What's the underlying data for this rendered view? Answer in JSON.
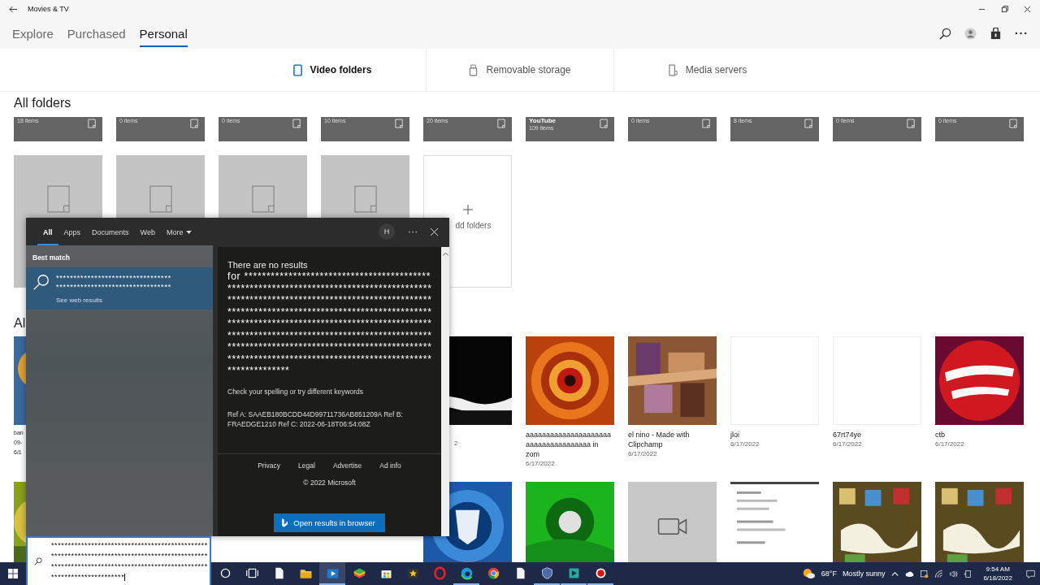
{
  "window": {
    "title": "Movies & TV"
  },
  "nav_tabs": [
    {
      "label": "Explore",
      "selected": false
    },
    {
      "label": "Purchased",
      "selected": false
    },
    {
      "label": "Personal",
      "selected": true
    }
  ],
  "sources": [
    {
      "label": "Video folders",
      "selected": true,
      "kind": "device"
    },
    {
      "label": "Removable storage",
      "selected": false,
      "kind": "usb"
    },
    {
      "label": "Media servers",
      "selected": false,
      "kind": "server"
    }
  ],
  "folders": {
    "heading": "All folders",
    "top_row": [
      {
        "count": "18 items"
      },
      {
        "count": "0 items"
      },
      {
        "count": "0 items"
      },
      {
        "count": "10 items"
      },
      {
        "count": "20 items"
      },
      {
        "name": "YouTube",
        "count": "109 items"
      },
      {
        "count": "0 items"
      },
      {
        "count": "8 items"
      },
      {
        "count": "0 items"
      },
      {
        "count": "0 items"
      }
    ],
    "add_label": "dd folders"
  },
  "videos": {
    "heading": "Al",
    "left_fragment": [
      "ban",
      "09-",
      "6/1"
    ],
    "peek_date": "2",
    "row1": [
      {
        "title": "aaaaaaaaaaaaaaaaaaaaa aaaaaaaaaaaaaaaa in zom",
        "date": "6/17/2022",
        "kind": "picture"
      },
      {
        "title": "el nino - Made with Clipchamp",
        "date": "6/17/2022",
        "kind": "picture"
      },
      {
        "title": "jloi",
        "date": "6/17/2022",
        "kind": "blank"
      },
      {
        "title": "67rt74ye",
        "date": "6/17/2022",
        "kind": "blank"
      },
      {
        "title": "ctb",
        "date": "6/17/2022",
        "kind": "picture"
      }
    ],
    "row2": [
      {
        "kind": "picture"
      },
      {
        "kind": "picture"
      },
      {
        "kind": "placeholder"
      },
      {
        "kind": "picture"
      },
      {
        "kind": "picture"
      },
      {
        "kind": "picture"
      }
    ]
  },
  "search": {
    "tabs": [
      {
        "label": "All",
        "selected": true
      },
      {
        "label": "Apps",
        "selected": false
      },
      {
        "label": "Documents",
        "selected": false
      },
      {
        "label": "Web",
        "selected": false
      },
      {
        "label": "More",
        "selected": false
      }
    ],
    "user_initial": "H",
    "section": "Best match",
    "best_match_lines": [
      "*********************************",
      "*********************************"
    ],
    "see_web": "See web results",
    "no_results": "There are no results",
    "query": "for ******************************************************************************************************************************************************************************************************************************************************************************************************************************************************************************************",
    "hint": "Check your spelling or try different keywords",
    "ref": "Ref A: SAAEB180BCDD44D99711736AB851209A Ref B: FRAEDGE1210 Ref C: 2022-06-18T06:54:08Z",
    "footer_links": [
      "Privacy",
      "Legal",
      "Advertise",
      "Ad info"
    ],
    "copyright": "© 2022 Microsoft",
    "open_button": "Open results in browser",
    "box_text": "*******************************************************************************************************************************************************************"
  },
  "taskbar": {
    "apps": [
      {
        "kind": "cortana",
        "running": false
      },
      {
        "kind": "taskview",
        "running": false
      },
      {
        "kind": "file",
        "running": false
      },
      {
        "kind": "folder",
        "running": false
      },
      {
        "kind": "movies",
        "running": true
      },
      {
        "kind": "stack",
        "running": false
      },
      {
        "kind": "store",
        "running": false
      },
      {
        "kind": "star",
        "running": false
      },
      {
        "kind": "opera",
        "running": false
      },
      {
        "kind": "edge",
        "running": true
      },
      {
        "kind": "chrome",
        "running": false
      },
      {
        "kind": "file",
        "running": false
      },
      {
        "kind": "shield",
        "running": true
      },
      {
        "kind": "clip",
        "running": true
      },
      {
        "kind": "record",
        "running": true
      }
    ],
    "temperature": "68°F",
    "weather": "Mostly sunny",
    "time": "9:54 AM",
    "date": "6/18/2022"
  }
}
